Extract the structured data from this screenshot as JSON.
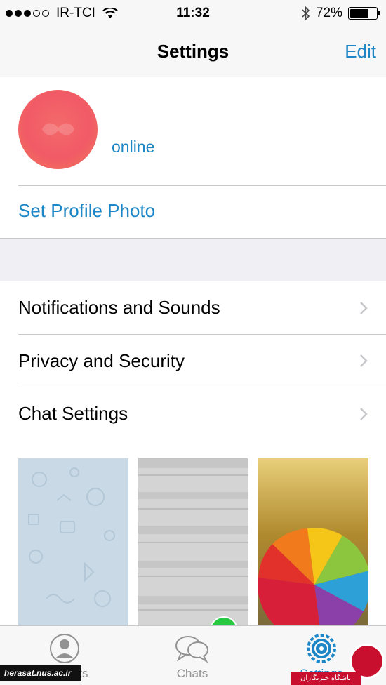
{
  "status_bar": {
    "carrier": "IR-TCI",
    "time": "11:32",
    "battery_percent_label": "72%",
    "battery_level": 0.72
  },
  "nav": {
    "title": "Settings",
    "edit_label": "Edit"
  },
  "profile": {
    "status": "online",
    "set_photo_label": "Set Profile Photo"
  },
  "settings_list": {
    "items": [
      {
        "label": "Notifications and Sounds"
      },
      {
        "label": "Privacy and Security"
      },
      {
        "label": "Chat Settings"
      }
    ]
  },
  "tab_bar": {
    "tabs": [
      {
        "label": "Contacts"
      },
      {
        "label": "Chats"
      },
      {
        "label": "Settings"
      }
    ]
  },
  "watermarks": {
    "left_text": "herasat.nus.ac.ir",
    "right_text": "باشگاه خبرنگاران"
  },
  "colors": {
    "accent": "#1c86c6",
    "avatar": "#f15a66",
    "selected_check": "#28c840"
  }
}
